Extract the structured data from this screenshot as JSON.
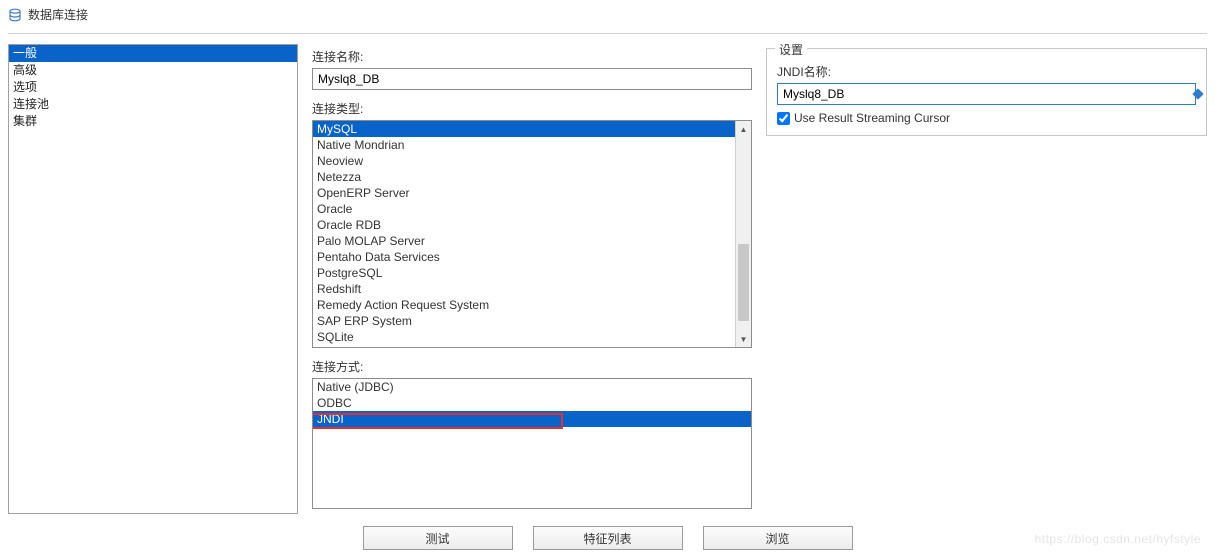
{
  "window": {
    "title": "数据库连接"
  },
  "sidebar": {
    "items": [
      {
        "label": "一般",
        "selected": true
      },
      {
        "label": "高级",
        "selected": false
      },
      {
        "label": "选项",
        "selected": false
      },
      {
        "label": "连接池",
        "selected": false
      },
      {
        "label": "集群",
        "selected": false
      }
    ]
  },
  "form": {
    "conn_name_label": "连接名称:",
    "conn_name_value": "Myslq8_DB",
    "conn_type_label": "连接类型:",
    "conn_types": [
      {
        "label": "MySQL",
        "selected": true
      },
      {
        "label": "Native Mondrian"
      },
      {
        "label": "Neoview"
      },
      {
        "label": "Netezza"
      },
      {
        "label": "OpenERP Server"
      },
      {
        "label": "Oracle"
      },
      {
        "label": "Oracle RDB"
      },
      {
        "label": "Palo MOLAP Server"
      },
      {
        "label": "Pentaho Data Services"
      },
      {
        "label": "PostgreSQL"
      },
      {
        "label": "Redshift"
      },
      {
        "label": "Remedy Action Request System"
      },
      {
        "label": "SAP ERP System"
      },
      {
        "label": "SQLite"
      }
    ],
    "conn_method_label": "连接方式:",
    "conn_methods": [
      {
        "label": "Native (JDBC)"
      },
      {
        "label": "ODBC"
      },
      {
        "label": "JNDI",
        "selected": true
      }
    ]
  },
  "settings": {
    "group_label": "设置",
    "jndi_name_label": "JNDI名称:",
    "jndi_name_value": "Myslq8_DB",
    "streaming_cursor_label": "Use Result Streaming Cursor",
    "streaming_cursor_checked": true
  },
  "buttons": {
    "test": "测试",
    "feature_list": "特征列表",
    "browse": "浏览"
  },
  "watermark": "https://blog.csdn.net/hyfstyle"
}
